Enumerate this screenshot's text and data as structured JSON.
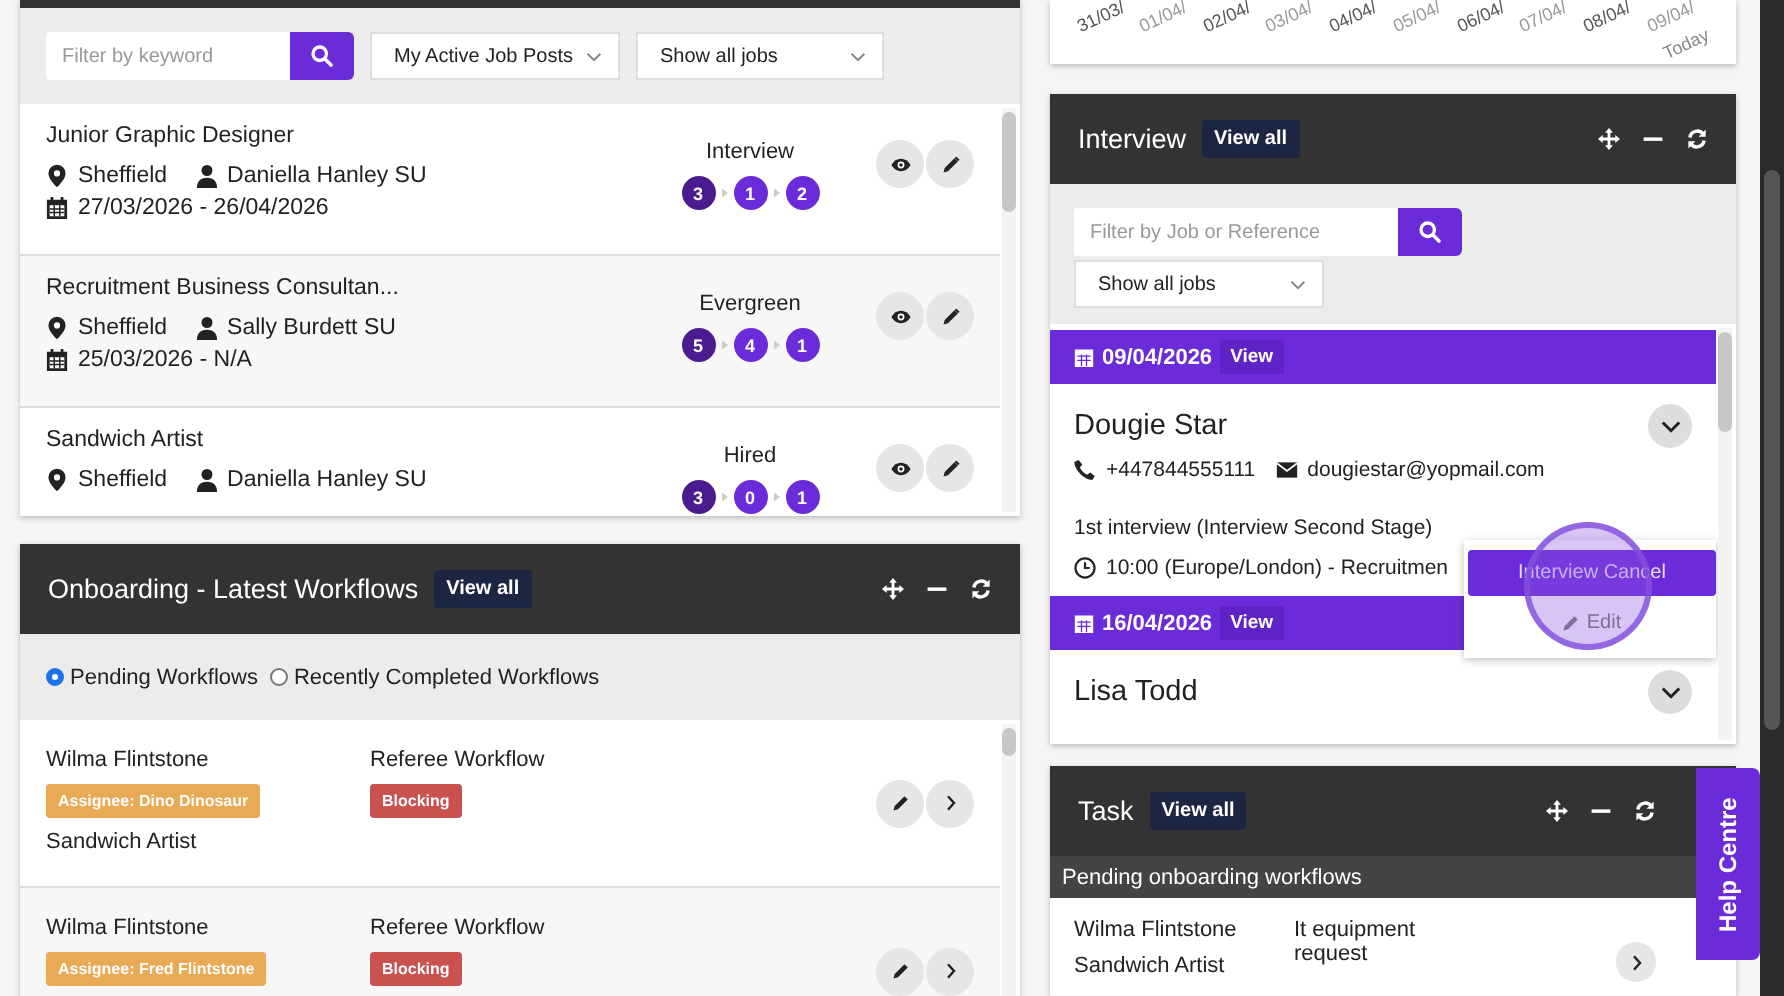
{
  "job_posts": {
    "filter": {
      "placeholder": "Filter by keyword"
    },
    "selects": [
      "My Active Job Posts",
      "Show all jobs"
    ],
    "rows": [
      {
        "title": "Junior Graphic Designer",
        "location": "Sheffield",
        "owner": "Daniella Hanley SU",
        "dates": "27/03/2026 - 26/04/2026",
        "stage": "Interview",
        "counts": [
          "3",
          "1",
          "2"
        ]
      },
      {
        "title": "Recruitment Business Consultan...",
        "location": "Sheffield",
        "owner": "Sally Burdett SU",
        "dates": "25/03/2026 - N/A",
        "stage": "Evergreen",
        "counts": [
          "5",
          "4",
          "1"
        ]
      },
      {
        "title": "Sandwich Artist",
        "location": "Sheffield",
        "owner": "Daniella Hanley SU",
        "stage": "Hired",
        "counts": [
          "3",
          "0",
          "1"
        ]
      }
    ]
  },
  "onboarding": {
    "title": "Onboarding - Latest Workflows",
    "view_all": "View all",
    "radios": [
      {
        "label": "Pending Workflows",
        "selected": true
      },
      {
        "label": "Recently Completed Workflows",
        "selected": false
      }
    ],
    "rows": [
      {
        "name": "Wilma Flintstone",
        "assignee": "Assignee: Dino Dinosaur",
        "job": "Sandwich Artist",
        "workflow": "Referee Workflow",
        "tag": "Blocking"
      },
      {
        "name": "Wilma Flintstone",
        "assignee": "Assignee: Fred Flintstone",
        "workflow": "Referee Workflow",
        "tag": "Blocking"
      }
    ]
  },
  "chart_axis": {
    "labels": [
      "31/03/",
      "01/04/",
      "02/04/",
      "03/04/",
      "04/04/",
      "05/04/",
      "06/04/",
      "07/04/",
      "08/04/",
      "09/04/"
    ],
    "today": "Today"
  },
  "interview": {
    "title": "Interview",
    "view_all": "View all",
    "filter": {
      "placeholder": "Filter by Job or Reference"
    },
    "select": "Show all jobs",
    "groups": [
      {
        "date": "09/04/2026",
        "view": "View",
        "name": "Dougie Star",
        "phone": "+447844555111",
        "email": "dougiestar@yopmail.com",
        "stage": "1st interview (Interview Second Stage)",
        "time": "10:00 (Europe/London) - Recruitmen",
        "menu": [
          "Interview Cancel",
          "Edit"
        ]
      },
      {
        "date": "16/04/2026",
        "view": "View",
        "name": "Lisa Todd"
      }
    ]
  },
  "task": {
    "title": "Task",
    "view_all": "View all",
    "section": "Pending onboarding workflows",
    "rows": [
      {
        "name": "Wilma Flintstone",
        "job": "Sandwich Artist",
        "task": "It equipment request"
      }
    ]
  },
  "help_tab": "Help Centre"
}
